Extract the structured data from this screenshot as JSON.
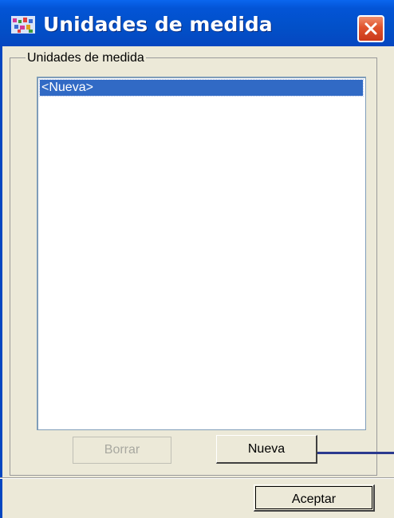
{
  "window": {
    "title": "Unidades de medida",
    "icon": "app-icon",
    "close_icon": "close-icon"
  },
  "group": {
    "label": "Unidades de medida"
  },
  "list": {
    "items": [
      "<Nueva>"
    ],
    "selected_index": 0
  },
  "buttons": {
    "delete_label": "Borrar",
    "new_label": "Nueva",
    "accept_label": "Aceptar"
  },
  "colors": {
    "titlebar": "#0354d6",
    "selection": "#316ac5",
    "dialog_background": "#ece9d8",
    "close_button": "#e0532c"
  }
}
